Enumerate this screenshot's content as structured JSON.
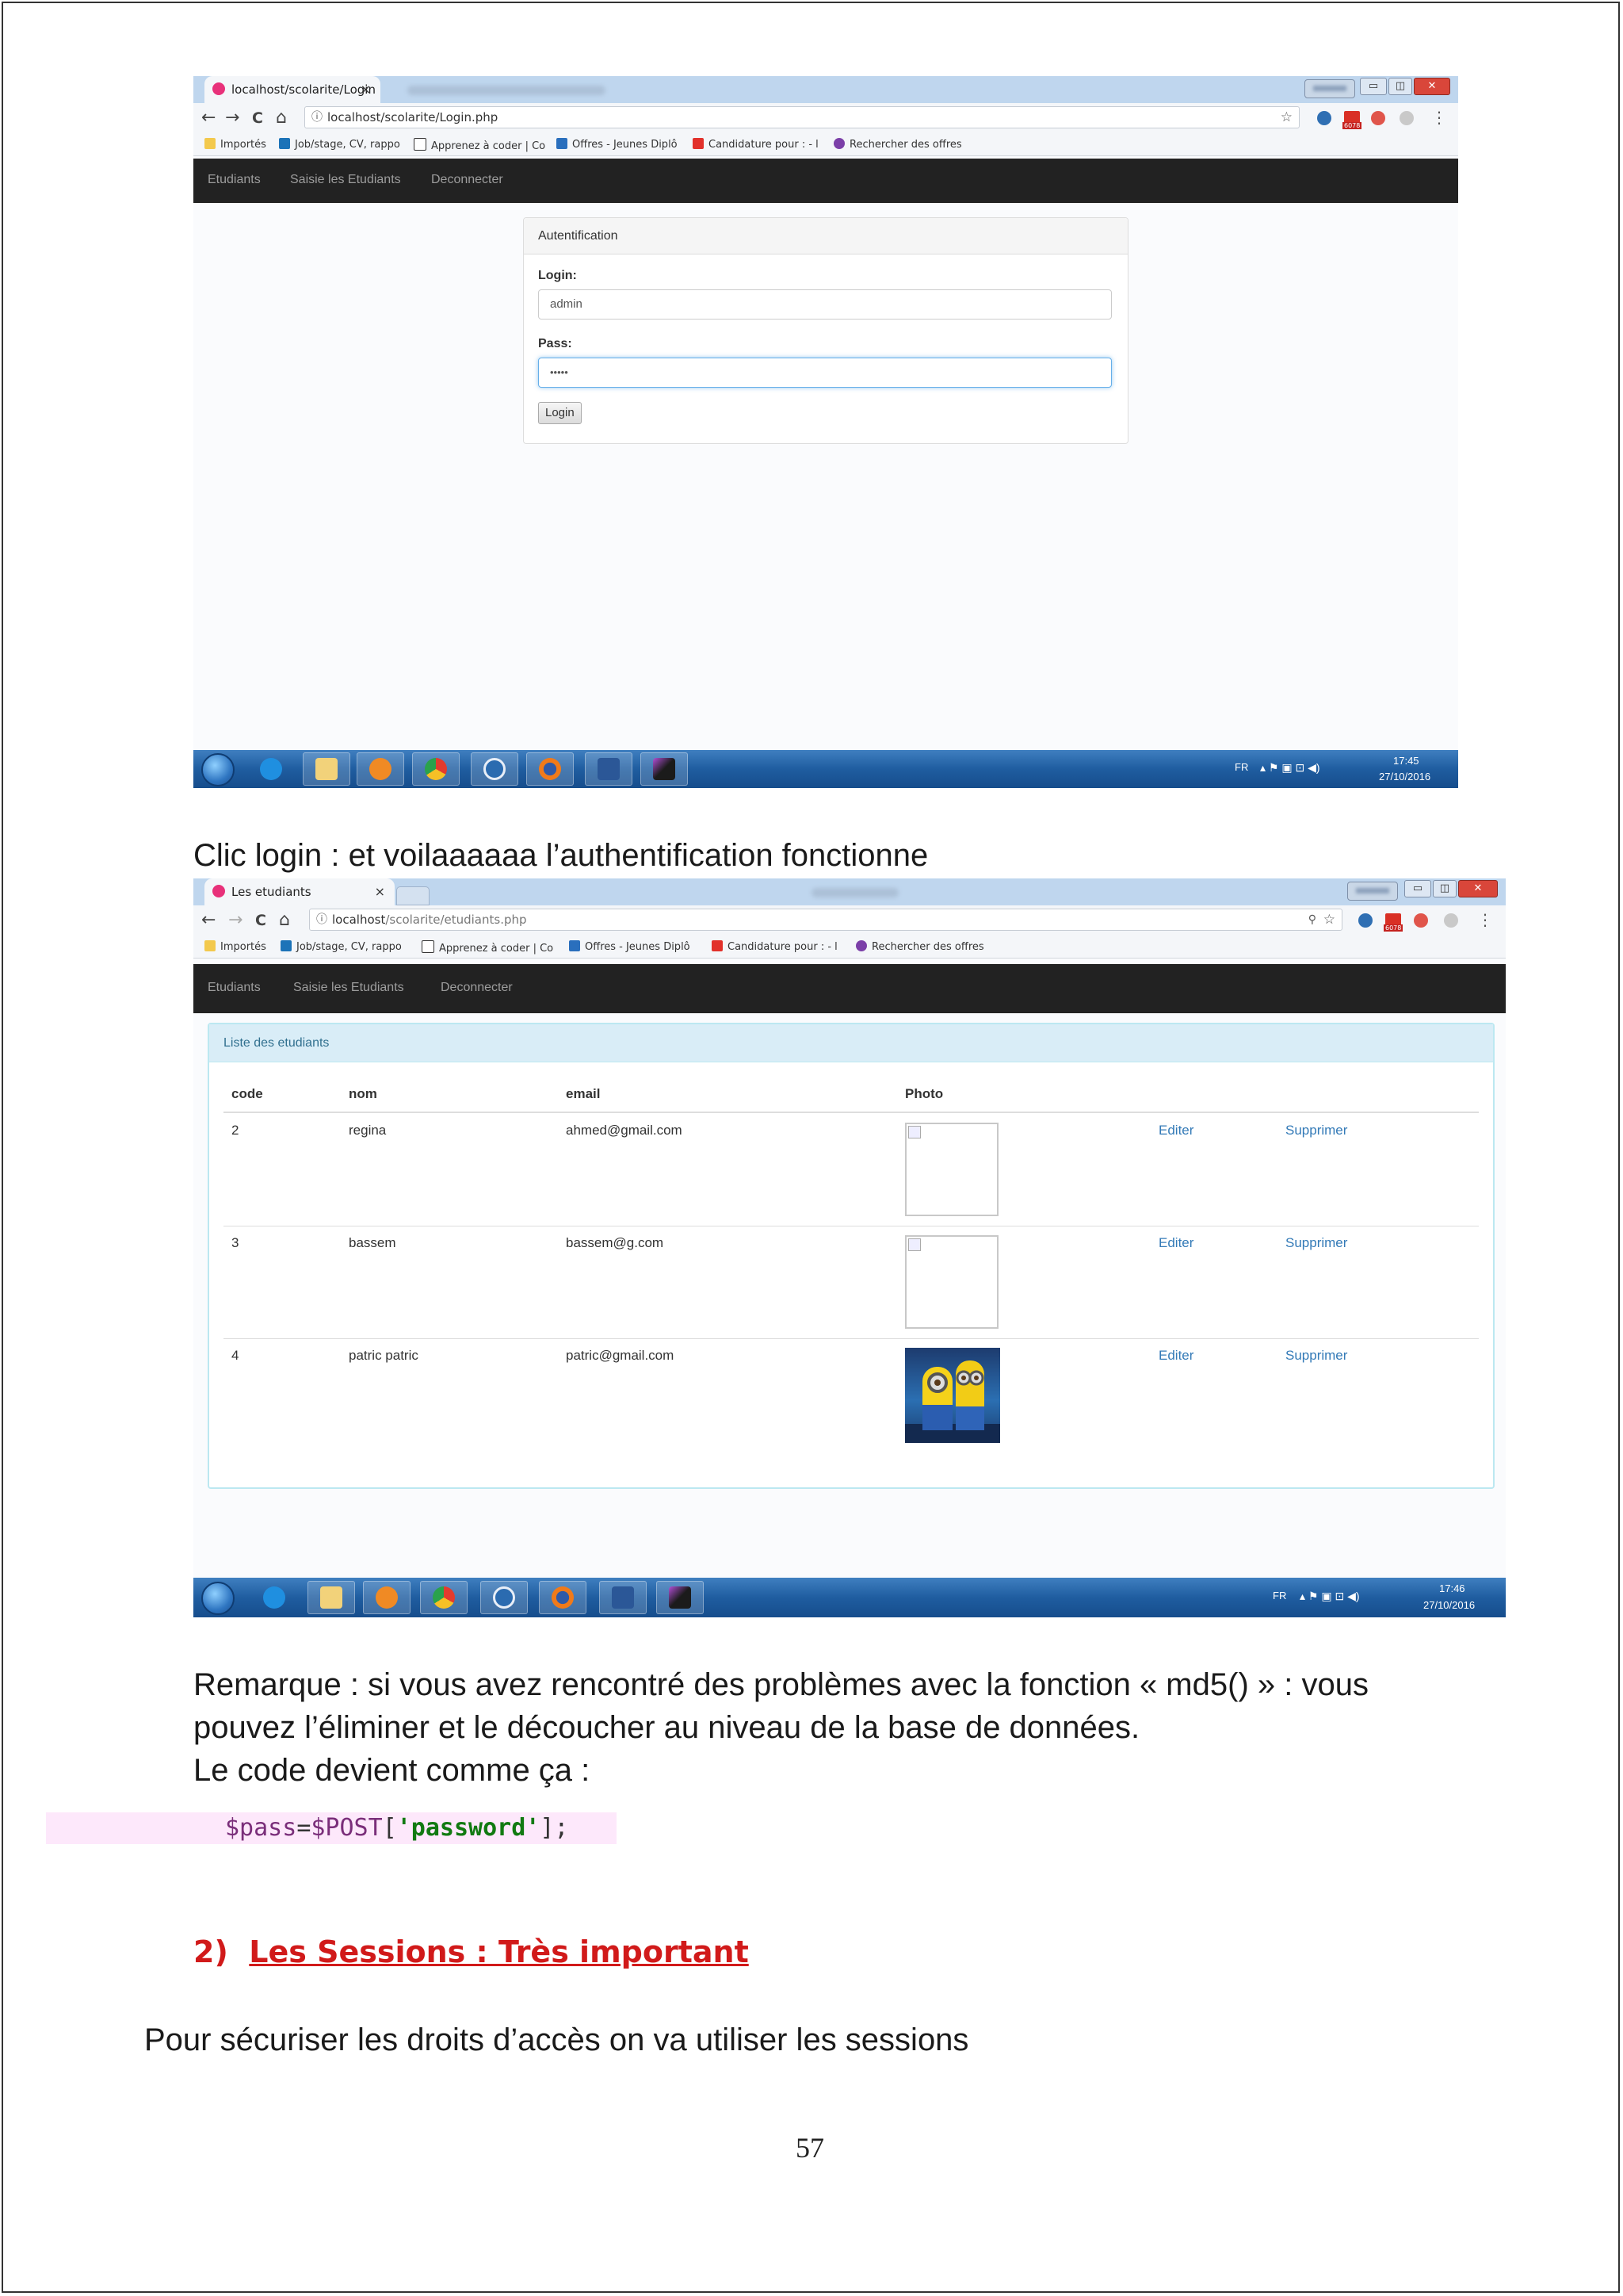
{
  "screenshot1": {
    "tab_title": "localhost/scolarite/Login",
    "tab_close": "×",
    "nav": {
      "back": "←",
      "forward": "→",
      "reload": "C",
      "home": "⌂"
    },
    "url": "localhost/scolarite/Login.php",
    "url_info": "ⓘ",
    "bookmark_star": "☆",
    "extension_badge": "6078",
    "menu_dots": "⋮",
    "bookmarks": [
      "Importés",
      "Job/stage, CV, rappo",
      "Apprenez à coder | Co",
      "Offres - Jeunes Diplô",
      "Candidature pour : - l",
      "Rechercher des offres"
    ],
    "menu": [
      "Etudiants",
      "Saisie les Etudiants",
      "Deconnecter"
    ],
    "panel_title": "Autentification",
    "login_label": "Login:",
    "login_value": "admin",
    "pass_label": "Pass:",
    "pass_value": "•••••",
    "login_button": "Login",
    "taskbar": {
      "lang": "FR",
      "time": "17:45",
      "date": "27/10/2016"
    }
  },
  "caption1": "Clic login : et voilaaaaaa l’authentification fonctionne",
  "screenshot2": {
    "tab_title": "Les etudiants",
    "tab_close": "×",
    "nav": {
      "back": "←",
      "forward": "→",
      "reload": "C",
      "home": "⌂"
    },
    "url_host": "localhost",
    "url_path": "/scolarite/etudiants.php",
    "url_info": "ⓘ",
    "bookmark_star": "☆",
    "key_icon": "⚲",
    "extension_badge": "6078",
    "menu_dots": "⋮",
    "bookmarks": [
      "Importés",
      "Job/stage, CV, rappo",
      "Apprenez à coder | Co",
      "Offres - Jeunes Diplô",
      "Candidature pour : - l",
      "Rechercher des offres"
    ],
    "menu": [
      "Etudiants",
      "Saisie les Etudiants",
      "Deconnecter"
    ],
    "panel_title": "Liste des etudiants",
    "columns": [
      "code",
      "nom",
      "email",
      "Photo"
    ],
    "rows": [
      {
        "code": "2",
        "nom": "regina",
        "email": "ahmed@gmail.com",
        "edit": "Editer",
        "delete": "Supprimer"
      },
      {
        "code": "3",
        "nom": "bassem",
        "email": "bassem@g.com",
        "edit": "Editer",
        "delete": "Supprimer"
      },
      {
        "code": "4",
        "nom": "patric patric",
        "email": "patric@gmail.com",
        "edit": "Editer",
        "delete": "Supprimer"
      }
    ],
    "taskbar": {
      "lang": "FR",
      "time": "17:46",
      "date": "27/10/2016"
    }
  },
  "remark_lines": [
    "Remarque : si vous avez rencontré des problèmes avec la fonction « md5() » : vous",
    "pouvez l’éliminer et le découcher au niveau de la base de données.",
    "Le code devient comme ça :"
  ],
  "code": {
    "var": "$pass",
    "op": "=",
    "obj": "$POST",
    "open": "[",
    "key": "'password'",
    "close": "];"
  },
  "section": {
    "number": "2)",
    "title": "Les Sessions : Très important"
  },
  "body_text": "Pour sécuriser les droits d’accès on va utiliser les sessions",
  "page_number": "57",
  "colors": {
    "navbar": "#222222",
    "link": "#337ab7",
    "panel_info_bg": "#d9edf7",
    "section_red": "#d11a1a",
    "code_highlight": "#fde8fb"
  }
}
